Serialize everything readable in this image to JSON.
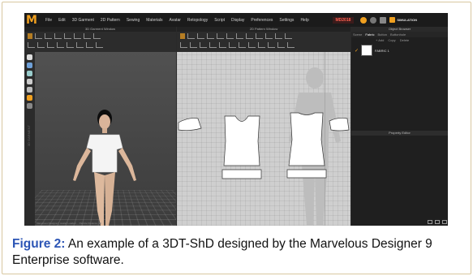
{
  "app": {
    "menu": [
      "File",
      "Edit",
      "3D Garment",
      "2D Pattern",
      "Sewing",
      "Materials",
      "Avatar",
      "Retopology",
      "Script",
      "Display",
      "Preferences",
      "Settings",
      "Help"
    ],
    "badge": "MD2018",
    "mode": "SIMULATION"
  },
  "panels": {
    "view3d_title": "3D Garment Window",
    "view3d_status": "Marvelous Designer | Avatar Loaded ... Particle Distance: 20",
    "view3d_side_label": "3D GARMENT",
    "pattern_title": "2D Pattern Window"
  },
  "object_browser": {
    "title": "Object Browser",
    "tabs": [
      "Scene",
      "Fabric",
      "Button",
      "Buttonhole"
    ],
    "active_tab": "Fabric",
    "actions": [
      "+ Add",
      "Copy",
      "Delete"
    ],
    "fabric_name": "FABRIC 1"
  },
  "property_editor": {
    "title": "Property Editor"
  },
  "colors": {
    "accent": "#f0a020",
    "caption_label": "#2c55b5"
  },
  "caption": {
    "label": "Figure 2:",
    "text": " An example of a 3DT-ShD designed by the Marvelous Designer 9 Enterprise software."
  }
}
